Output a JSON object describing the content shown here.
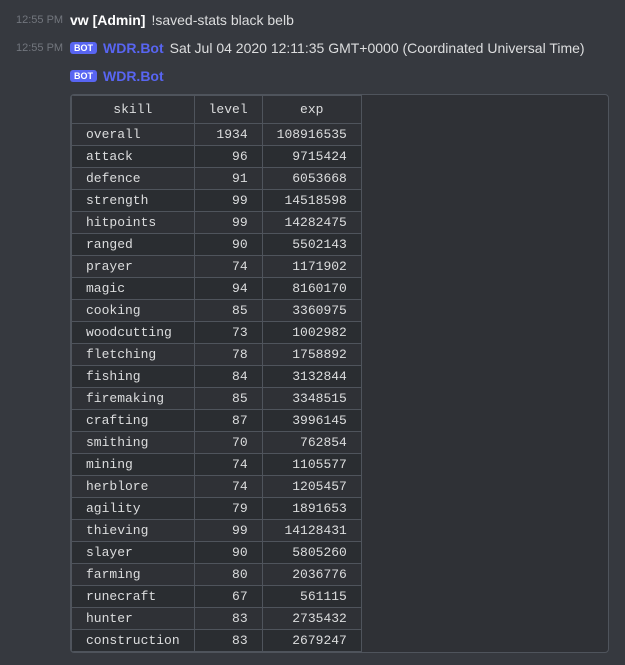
{
  "messages": [
    {
      "timestamp": "12:55 PM",
      "type": "user",
      "username": "vw [Admin]",
      "command": "!saved-stats black belb"
    },
    {
      "timestamp": "12:55 PM",
      "type": "bot",
      "bot_name": "WDR.Bot",
      "text": "Sat Jul 04 2020 12:11:35 GMT+0000 (Coordinated Universal Time)"
    },
    {
      "timestamp": "",
      "type": "bot-continuation",
      "bot_name": "WDR.Bot"
    }
  ],
  "table": {
    "headers": [
      "skill",
      "level",
      "exp"
    ],
    "rows": [
      [
        "overall",
        "1934",
        "108916535"
      ],
      [
        "attack",
        "96",
        "9715424"
      ],
      [
        "defence",
        "91",
        "6053668"
      ],
      [
        "strength",
        "99",
        "14518598"
      ],
      [
        "hitpoints",
        "99",
        "14282475"
      ],
      [
        "ranged",
        "90",
        "5502143"
      ],
      [
        "prayer",
        "74",
        "1171902"
      ],
      [
        "magic",
        "94",
        "8160170"
      ],
      [
        "cooking",
        "85",
        "3360975"
      ],
      [
        "woodcutting",
        "73",
        "1002982"
      ],
      [
        "fletching",
        "78",
        "1758892"
      ],
      [
        "fishing",
        "84",
        "3132844"
      ],
      [
        "firemaking",
        "85",
        "3348515"
      ],
      [
        "crafting",
        "87",
        "3996145"
      ],
      [
        "smithing",
        "70",
        "762854"
      ],
      [
        "mining",
        "74",
        "1105577"
      ],
      [
        "herblore",
        "74",
        "1205457"
      ],
      [
        "agility",
        "79",
        "1891653"
      ],
      [
        "thieving",
        "99",
        "14128431"
      ],
      [
        "slayer",
        "90",
        "5805260"
      ],
      [
        "farming",
        "80",
        "2036776"
      ],
      [
        "runecraft",
        "67",
        "561115"
      ],
      [
        "hunter",
        "83",
        "2735432"
      ],
      [
        "construction",
        "83",
        "2679247"
      ]
    ]
  },
  "ui": {
    "bot_badge": "BOT",
    "timestamp_color": "#72767d",
    "username_color": "#ffffff",
    "bot_name_color": "#5865f2",
    "accent_color": "#5865f2"
  }
}
